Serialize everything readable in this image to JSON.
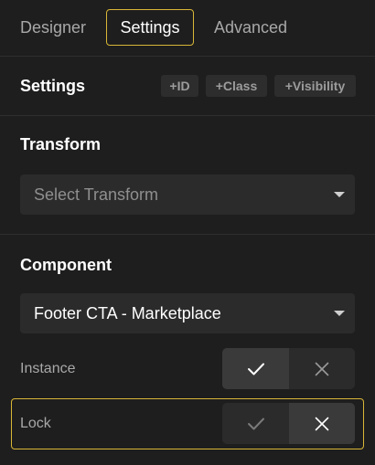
{
  "tabs": [
    {
      "label": "Designer",
      "active": false
    },
    {
      "label": "Settings",
      "active": true
    },
    {
      "label": "Advanced",
      "active": false
    }
  ],
  "settings": {
    "title": "Settings",
    "chips": [
      "+ID",
      "+Class",
      "+Visibility"
    ]
  },
  "transform": {
    "title": "Transform",
    "placeholder": "Select Transform"
  },
  "component": {
    "title": "Component",
    "selected": "Footer CTA - Marketplace"
  },
  "instance": {
    "label": "Instance",
    "value": true
  },
  "lock": {
    "label": "Lock",
    "value": false
  },
  "colors": {
    "accent": "#d9b637",
    "background": "#1e1e1e",
    "field": "#2b2b2b"
  }
}
